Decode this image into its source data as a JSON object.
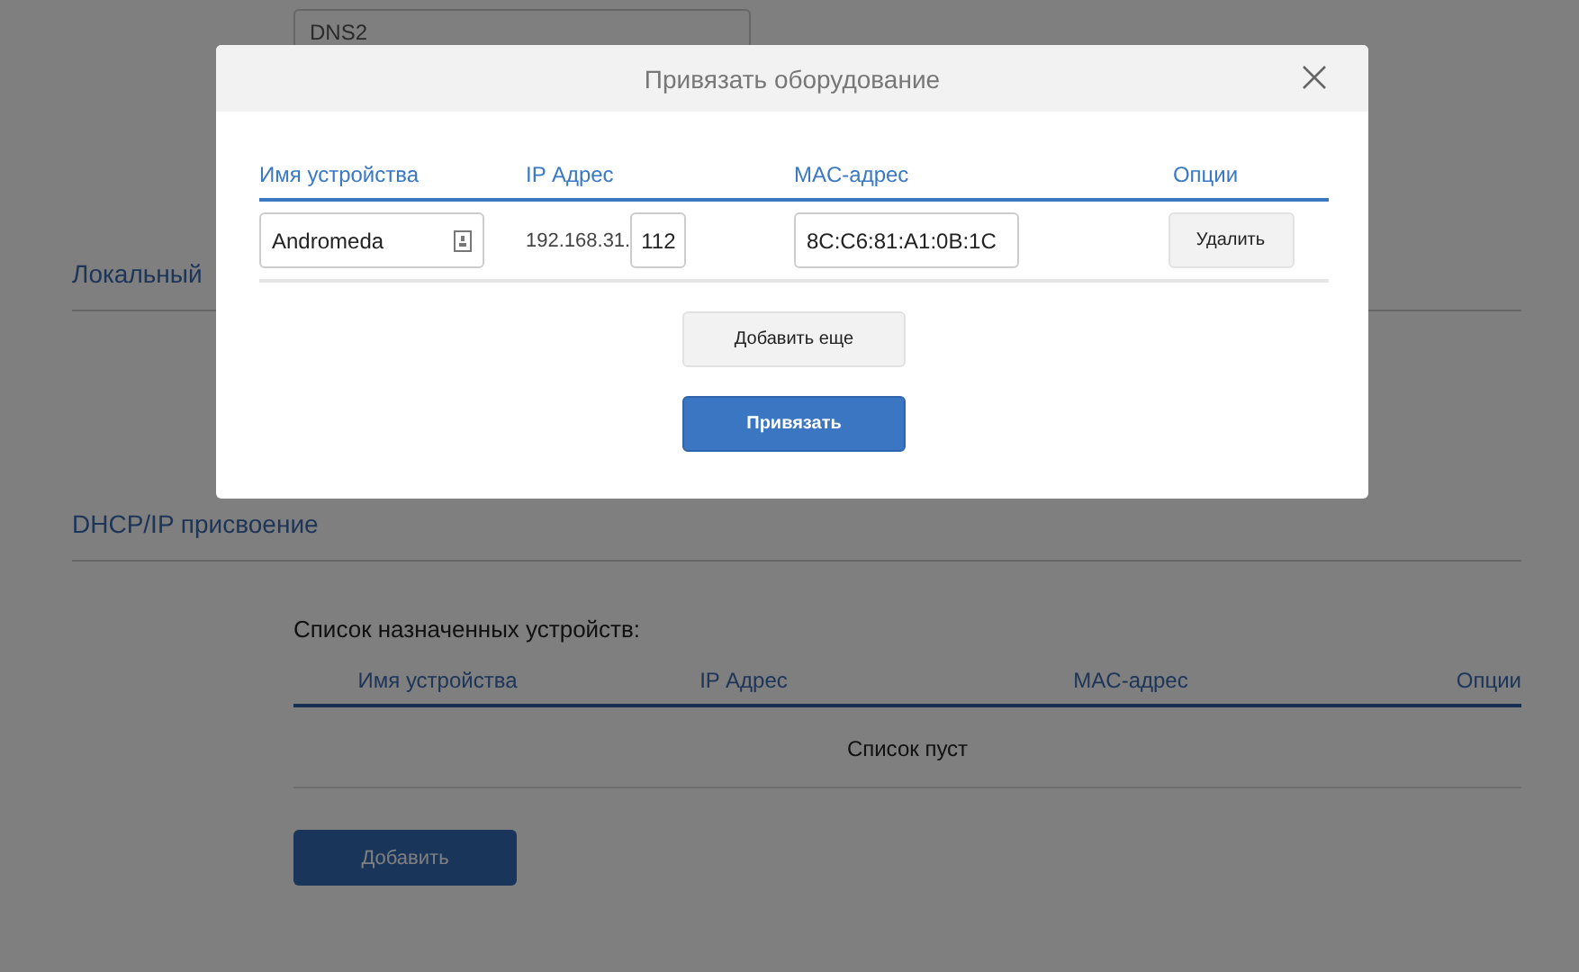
{
  "page": {
    "dns2_field": {
      "placeholder": "DNS2"
    },
    "sections": [
      {
        "title": "Локальный"
      },
      {
        "title": "DHCP/IP присвоение"
      }
    ],
    "assigned": {
      "caption": "Список назначенных устройств:",
      "columns": [
        "Имя устройства",
        "IP Адрес",
        "MAC-адрес",
        "Опции"
      ],
      "empty_text": "Список пуст",
      "add_button": "Добавить"
    }
  },
  "dialog": {
    "title": "Привязать оборудование",
    "columns": [
      "Имя устройства",
      "IP Адрес",
      "MAC-адрес",
      "Опции"
    ],
    "rows": [
      {
        "name": "Andromeda",
        "ip_prefix": "192.168.31.",
        "ip_suffix": "112",
        "mac": "8C:C6:81:A1:0B:1C",
        "delete_button": "Удалить"
      }
    ],
    "add_more_button": "Добавить еще",
    "bind_button": "Привязать"
  }
}
